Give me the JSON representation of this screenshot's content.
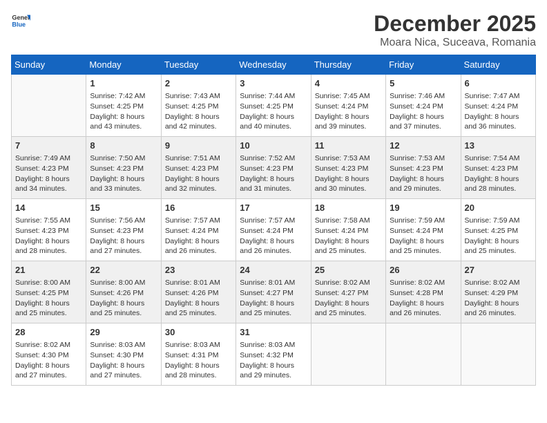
{
  "header": {
    "logo_general": "General",
    "logo_blue": "Blue",
    "main_title": "December 2025",
    "subtitle": "Moara Nica, Suceava, Romania"
  },
  "calendar": {
    "days_of_week": [
      "Sunday",
      "Monday",
      "Tuesday",
      "Wednesday",
      "Thursday",
      "Friday",
      "Saturday"
    ],
    "weeks": [
      [
        {
          "day": "",
          "info": ""
        },
        {
          "day": "1",
          "info": "Sunrise: 7:42 AM\nSunset: 4:25 PM\nDaylight: 8 hours\nand 43 minutes."
        },
        {
          "day": "2",
          "info": "Sunrise: 7:43 AM\nSunset: 4:25 PM\nDaylight: 8 hours\nand 42 minutes."
        },
        {
          "day": "3",
          "info": "Sunrise: 7:44 AM\nSunset: 4:25 PM\nDaylight: 8 hours\nand 40 minutes."
        },
        {
          "day": "4",
          "info": "Sunrise: 7:45 AM\nSunset: 4:24 PM\nDaylight: 8 hours\nand 39 minutes."
        },
        {
          "day": "5",
          "info": "Sunrise: 7:46 AM\nSunset: 4:24 PM\nDaylight: 8 hours\nand 37 minutes."
        },
        {
          "day": "6",
          "info": "Sunrise: 7:47 AM\nSunset: 4:24 PM\nDaylight: 8 hours\nand 36 minutes."
        }
      ],
      [
        {
          "day": "7",
          "info": "Sunrise: 7:49 AM\nSunset: 4:23 PM\nDaylight: 8 hours\nand 34 minutes."
        },
        {
          "day": "8",
          "info": "Sunrise: 7:50 AM\nSunset: 4:23 PM\nDaylight: 8 hours\nand 33 minutes."
        },
        {
          "day": "9",
          "info": "Sunrise: 7:51 AM\nSunset: 4:23 PM\nDaylight: 8 hours\nand 32 minutes."
        },
        {
          "day": "10",
          "info": "Sunrise: 7:52 AM\nSunset: 4:23 PM\nDaylight: 8 hours\nand 31 minutes."
        },
        {
          "day": "11",
          "info": "Sunrise: 7:53 AM\nSunset: 4:23 PM\nDaylight: 8 hours\nand 30 minutes."
        },
        {
          "day": "12",
          "info": "Sunrise: 7:53 AM\nSunset: 4:23 PM\nDaylight: 8 hours\nand 29 minutes."
        },
        {
          "day": "13",
          "info": "Sunrise: 7:54 AM\nSunset: 4:23 PM\nDaylight: 8 hours\nand 28 minutes."
        }
      ],
      [
        {
          "day": "14",
          "info": "Sunrise: 7:55 AM\nSunset: 4:23 PM\nDaylight: 8 hours\nand 28 minutes."
        },
        {
          "day": "15",
          "info": "Sunrise: 7:56 AM\nSunset: 4:23 PM\nDaylight: 8 hours\nand 27 minutes."
        },
        {
          "day": "16",
          "info": "Sunrise: 7:57 AM\nSunset: 4:24 PM\nDaylight: 8 hours\nand 26 minutes."
        },
        {
          "day": "17",
          "info": "Sunrise: 7:57 AM\nSunset: 4:24 PM\nDaylight: 8 hours\nand 26 minutes."
        },
        {
          "day": "18",
          "info": "Sunrise: 7:58 AM\nSunset: 4:24 PM\nDaylight: 8 hours\nand 25 minutes."
        },
        {
          "day": "19",
          "info": "Sunrise: 7:59 AM\nSunset: 4:24 PM\nDaylight: 8 hours\nand 25 minutes."
        },
        {
          "day": "20",
          "info": "Sunrise: 7:59 AM\nSunset: 4:25 PM\nDaylight: 8 hours\nand 25 minutes."
        }
      ],
      [
        {
          "day": "21",
          "info": "Sunrise: 8:00 AM\nSunset: 4:25 PM\nDaylight: 8 hours\nand 25 minutes."
        },
        {
          "day": "22",
          "info": "Sunrise: 8:00 AM\nSunset: 4:26 PM\nDaylight: 8 hours\nand 25 minutes."
        },
        {
          "day": "23",
          "info": "Sunrise: 8:01 AM\nSunset: 4:26 PM\nDaylight: 8 hours\nand 25 minutes."
        },
        {
          "day": "24",
          "info": "Sunrise: 8:01 AM\nSunset: 4:27 PM\nDaylight: 8 hours\nand 25 minutes."
        },
        {
          "day": "25",
          "info": "Sunrise: 8:02 AM\nSunset: 4:27 PM\nDaylight: 8 hours\nand 25 minutes."
        },
        {
          "day": "26",
          "info": "Sunrise: 8:02 AM\nSunset: 4:28 PM\nDaylight: 8 hours\nand 26 minutes."
        },
        {
          "day": "27",
          "info": "Sunrise: 8:02 AM\nSunset: 4:29 PM\nDaylight: 8 hours\nand 26 minutes."
        }
      ],
      [
        {
          "day": "28",
          "info": "Sunrise: 8:02 AM\nSunset: 4:30 PM\nDaylight: 8 hours\nand 27 minutes."
        },
        {
          "day": "29",
          "info": "Sunrise: 8:03 AM\nSunset: 4:30 PM\nDaylight: 8 hours\nand 27 minutes."
        },
        {
          "day": "30",
          "info": "Sunrise: 8:03 AM\nSunset: 4:31 PM\nDaylight: 8 hours\nand 28 minutes."
        },
        {
          "day": "31",
          "info": "Sunrise: 8:03 AM\nSunset: 4:32 PM\nDaylight: 8 hours\nand 29 minutes."
        },
        {
          "day": "",
          "info": ""
        },
        {
          "day": "",
          "info": ""
        },
        {
          "day": "",
          "info": ""
        }
      ]
    ]
  }
}
